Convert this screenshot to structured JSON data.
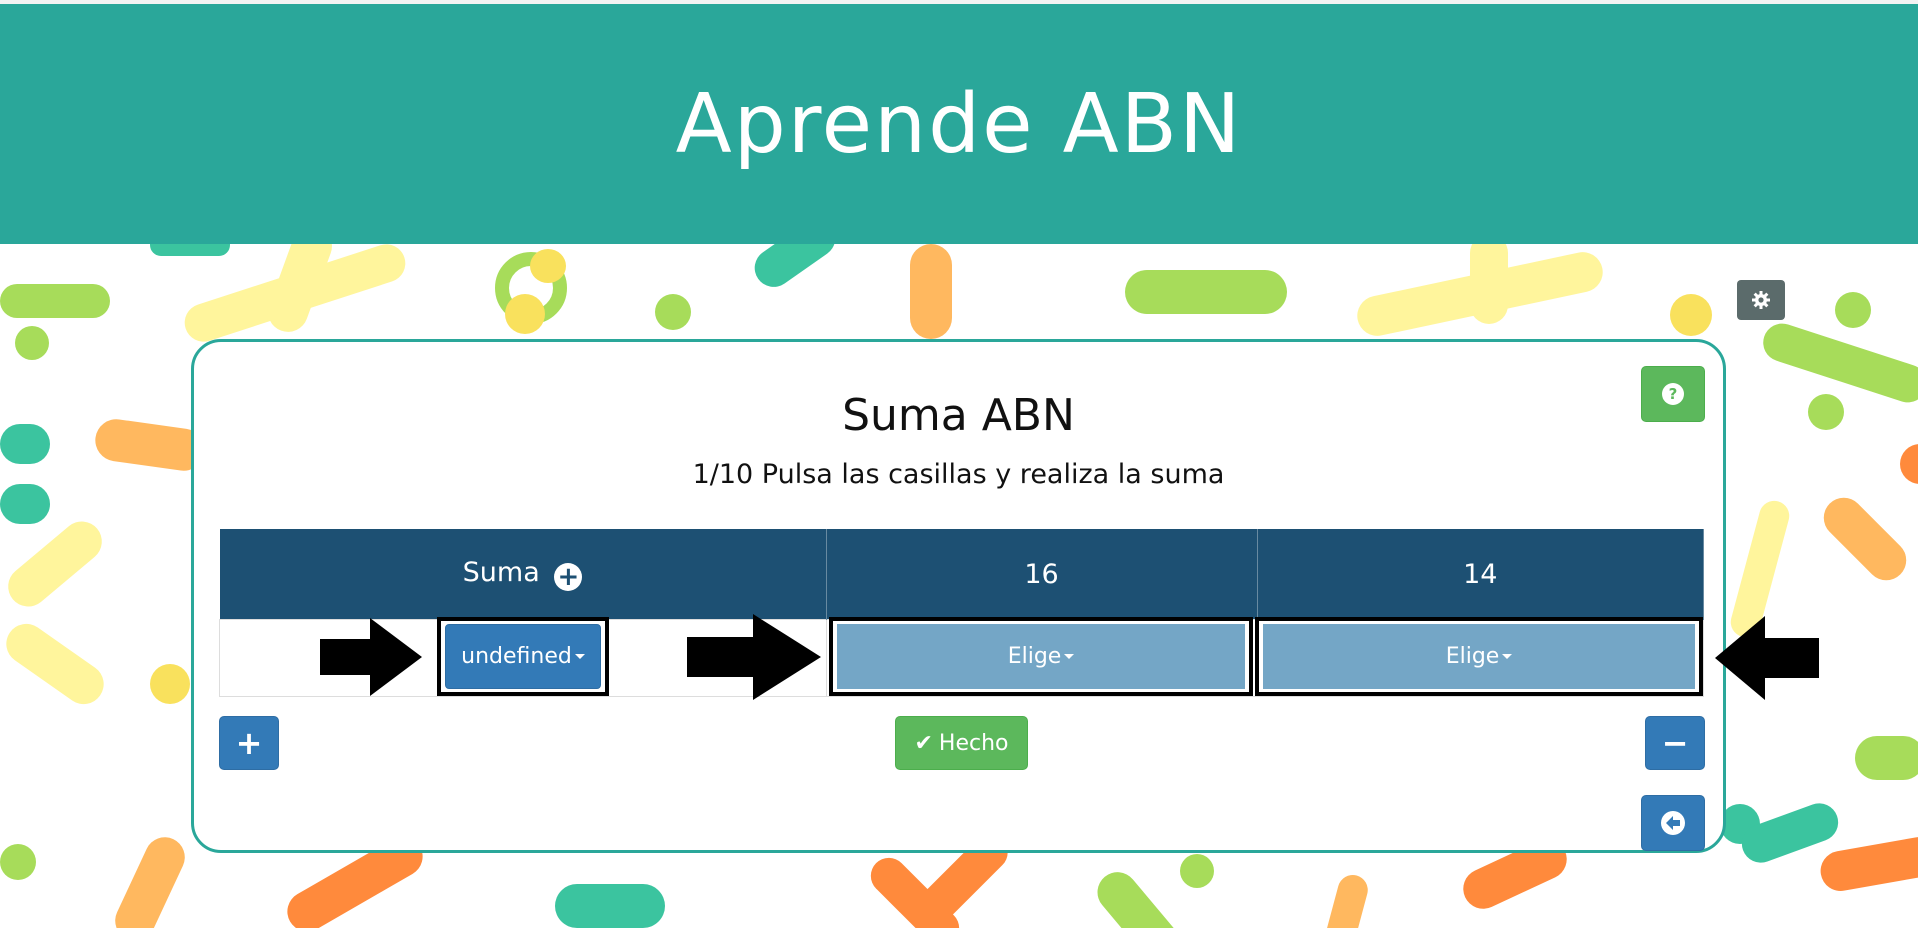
{
  "header": {
    "title": "Aprende ABN"
  },
  "settings_icon": "gear-icon",
  "card": {
    "title": "Suma ABN",
    "subtitle": "1/10 Pulsa las casillas y realiza la suma",
    "help_icon": "question-circle-icon"
  },
  "table": {
    "headers": [
      {
        "label": "Suma",
        "icon": "plus-circle-icon"
      },
      {
        "label": "16"
      },
      {
        "label": "14"
      }
    ],
    "row": {
      "dropdowns": [
        "undefined",
        "Elige",
        "Elige"
      ]
    }
  },
  "buttons": {
    "add_row": "+",
    "done": "Hecho",
    "remove_row": "−",
    "back_icon": "arrow-circle-left-icon"
  },
  "colors": {
    "header_teal": "#2aa79a",
    "table_header": "#1d5073",
    "primary_blue": "#337ab7",
    "success_green": "#5cb85c",
    "light_select": "#74a6c6"
  }
}
